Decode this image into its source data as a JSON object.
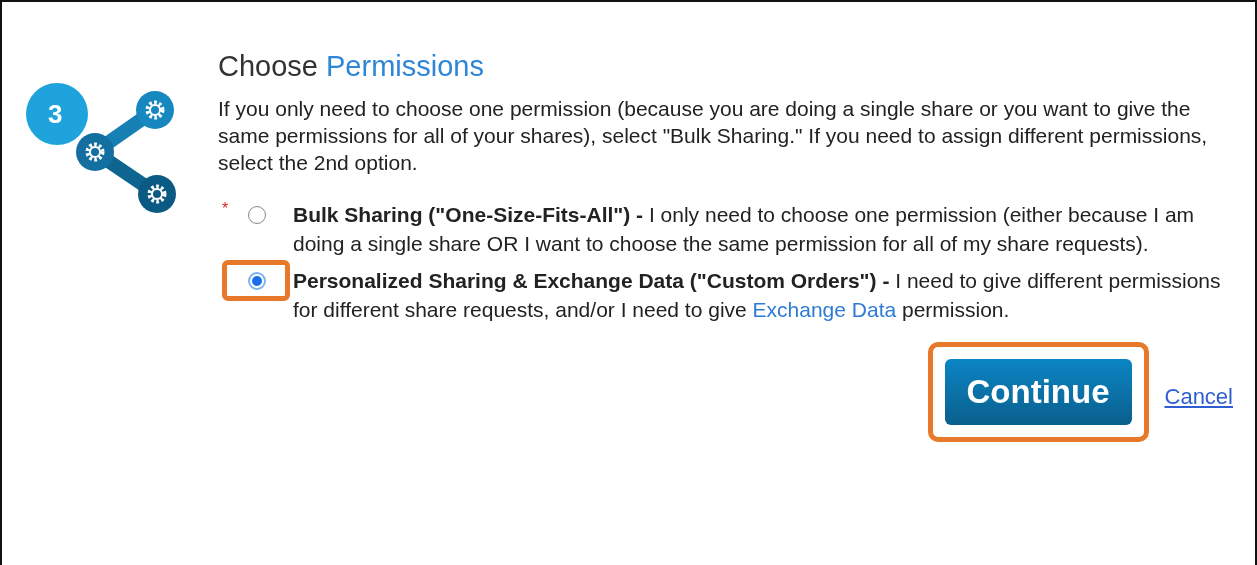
{
  "step": {
    "number": "3"
  },
  "title": {
    "plain": "Choose",
    "accent": "Permissions"
  },
  "intro": "If you only need to choose one permission (because you are doing a single share or you want to give the same permissions for all of your shares), select \"Bulk Sharing.\" If you need to assign different permissions, select the 2nd option.",
  "options": [
    {
      "required_mark": "*",
      "text": "**Bulk Sharing (\"One-Size-Fits-All\") -** I only need to choose one permission (either because I am doing a single share OR I want to choose the same permission for all of my share requests).",
      "selected": false,
      "highlighted": false
    },
    {
      "text": "**Personalized Sharing & Exchange Data (\"Custom Orders\") -** I need to give different permissions for different share requests, and/or I need to give ",
      "link": "Exchange Data",
      "text_end": " permission.",
      "selected": true,
      "highlighted": true
    }
  ],
  "buttons": {
    "continue": {
      "label": "Continue",
      "highlighted": true
    },
    "cancel": {
      "label": "Cancel"
    }
  }
}
